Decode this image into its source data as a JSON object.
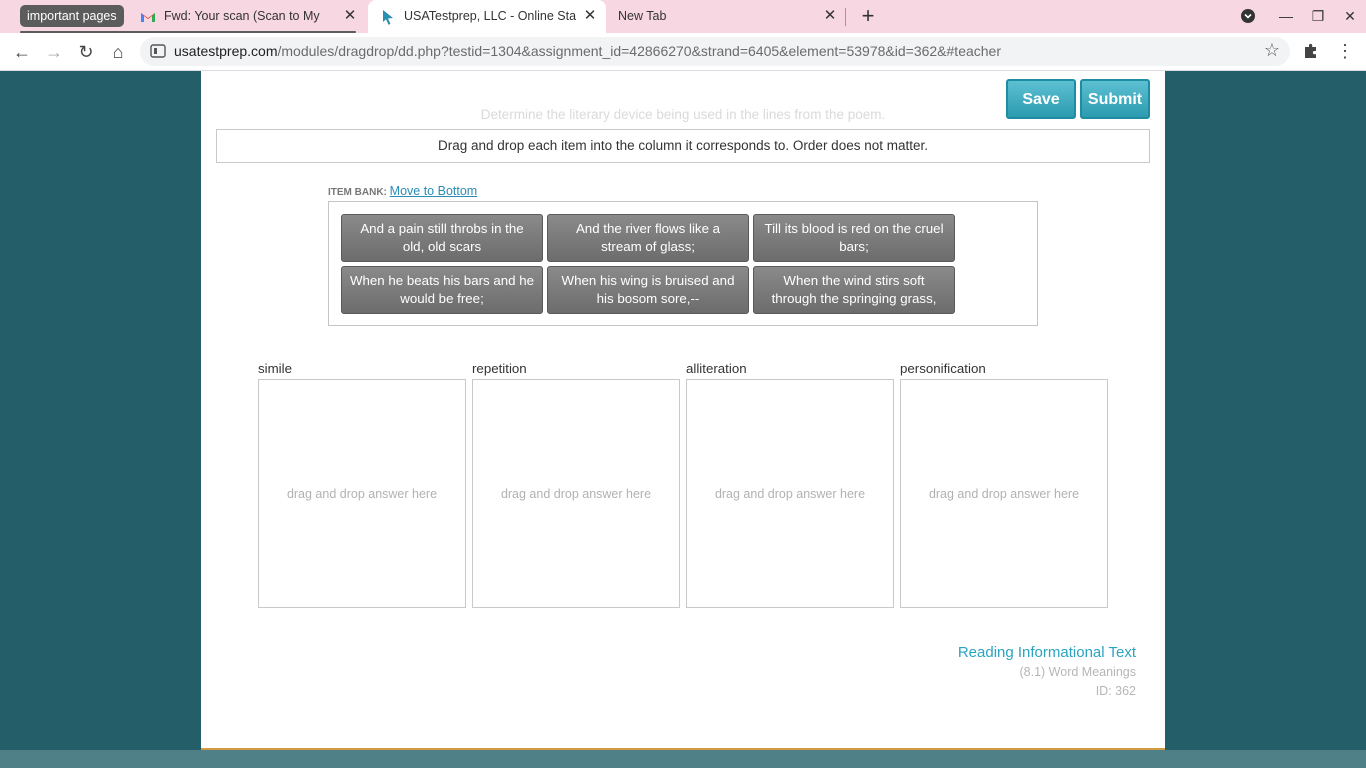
{
  "browser": {
    "tab_group_label": "important pages",
    "tabs": [
      {
        "title": "Fwd: Your scan (Scan to My Ema",
        "favicon": "gmail-icon"
      },
      {
        "title": "USATestprep, LLC - Online State-S",
        "favicon": "cursor-arrow-icon",
        "active": true
      },
      {
        "title": "New Tab",
        "favicon": ""
      }
    ],
    "url_host": "usatestprep.com",
    "url_path": "/modules/dragdrop/dd.php?testid=1304&assignment_id=42866270&strand=6405&element=53978&id=362&#teacher"
  },
  "toolbar": {
    "save_label": "Save",
    "submit_label": "Submit"
  },
  "question": {
    "prompt_faded": "Determine the literary device being used in the lines from the poem.",
    "instructions": "Drag and drop each item into the column it corresponds to. Order does not matter."
  },
  "item_bank": {
    "label": "ITEM BANK:",
    "move_link": "Move to Bottom",
    "items": [
      "And a pain still throbs in the old, old scars",
      "And the river flows like a stream of glass;",
      "Till its blood is red on the cruel bars;",
      "When he beats his bars and he would be free;",
      "When his wing is bruised and his bosom sore,--",
      "When the wind stirs soft through the springing grass,"
    ]
  },
  "columns": [
    {
      "label": "simile",
      "placeholder": "drag and drop answer here"
    },
    {
      "label": "repetition",
      "placeholder": "drag and drop answer here"
    },
    {
      "label": "alliteration",
      "placeholder": "drag and drop answer here"
    },
    {
      "label": "personification",
      "placeholder": "drag and drop answer here"
    }
  ],
  "footer": {
    "subject": "Reading Informational Text",
    "standard": "(8.1) Word Meanings",
    "id_label": "ID: 362"
  },
  "colors": {
    "background": "#245f69",
    "accent": "#2ba4bf",
    "chip": "#7a7a7a"
  }
}
